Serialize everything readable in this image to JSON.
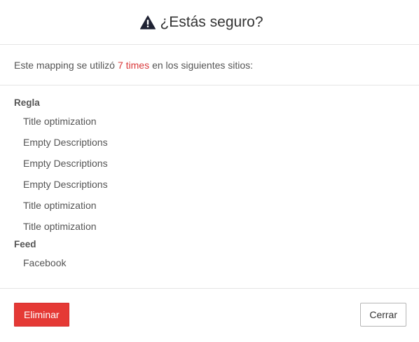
{
  "header": {
    "title": "¿Estás seguro?",
    "icon": "warning-triangle-icon"
  },
  "intro": {
    "prefix": "Este mapping se utilizó",
    "times": "7 times",
    "suffix": "en los siguientes sitios:",
    "times_color": "#d9383a"
  },
  "groups": [
    {
      "title": "Regla",
      "items": [
        "Title optimization",
        "Empty Descriptions",
        "Empty Descriptions",
        "Empty Descriptions",
        "Title optimization",
        "Title optimization"
      ]
    },
    {
      "title": "Feed",
      "items": [
        "Facebook"
      ]
    }
  ],
  "footer": {
    "delete_label": "Eliminar",
    "close_label": "Cerrar",
    "delete_color": "#e53935"
  }
}
